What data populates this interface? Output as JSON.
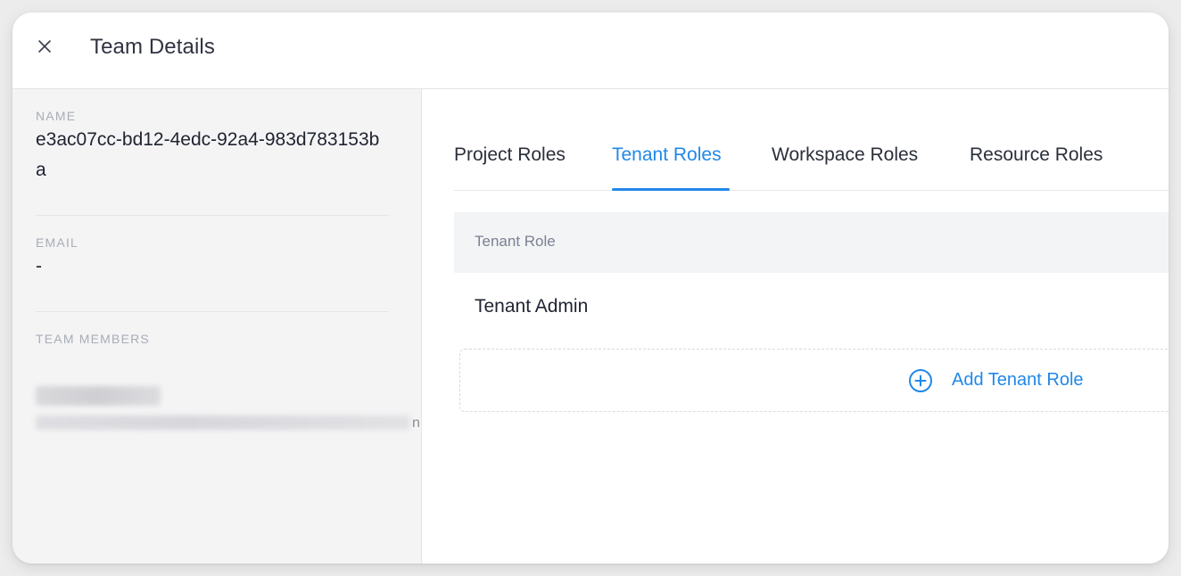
{
  "header": {
    "title": "Team Details",
    "close_icon": "close-icon"
  },
  "details": {
    "name_label": "NAME",
    "name_value": "e3ac07cc-bd12-4edc-92a4-983d783153ba",
    "email_label": "EMAIL",
    "email_value": "-",
    "members_label": "TEAM MEMBERS",
    "member_tail": "n"
  },
  "tabs": [
    {
      "label": "Project Roles",
      "active": false
    },
    {
      "label": "Tenant Roles",
      "active": true
    },
    {
      "label": "Workspace Roles",
      "active": false
    },
    {
      "label": "Resource Roles",
      "active": false
    }
  ],
  "table": {
    "header": "Tenant Role",
    "rows": [
      "Tenant Admin"
    ]
  },
  "add_button": {
    "label": "Add Tenant Role",
    "icon": "plus-circle-icon"
  },
  "colors": {
    "accent": "#2188e8",
    "left_panel_bg": "#f4f4f5",
    "table_header_bg": "#f3f4f6"
  }
}
